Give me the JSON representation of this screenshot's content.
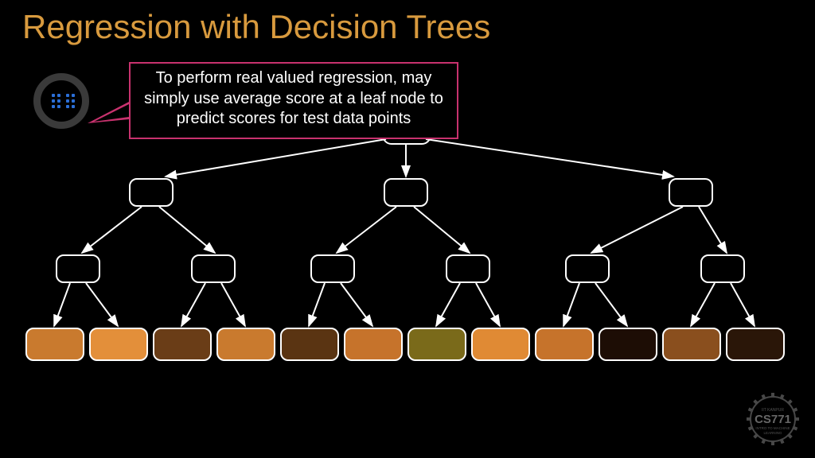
{
  "title": "Regression with Decision Trees",
  "callout_text": "To perform real valued regression, may simply use average score at a leaf node to predict scores for test data points",
  "leaf_colors": [
    "#c97a2e",
    "#e38f3a",
    "#6a3d17",
    "#c97a2e",
    "#5a3412",
    "#c6732b",
    "#7a6a1a",
    "#e08a34",
    "#c6732b",
    "#1d0d05",
    "#8a4f1e",
    "#2a1608"
  ],
  "logo": {
    "top": "IIT KANPUR",
    "mid": "CS771",
    "bot1": "INTRO TO MACHINE",
    "bot2": "LEARNING"
  }
}
